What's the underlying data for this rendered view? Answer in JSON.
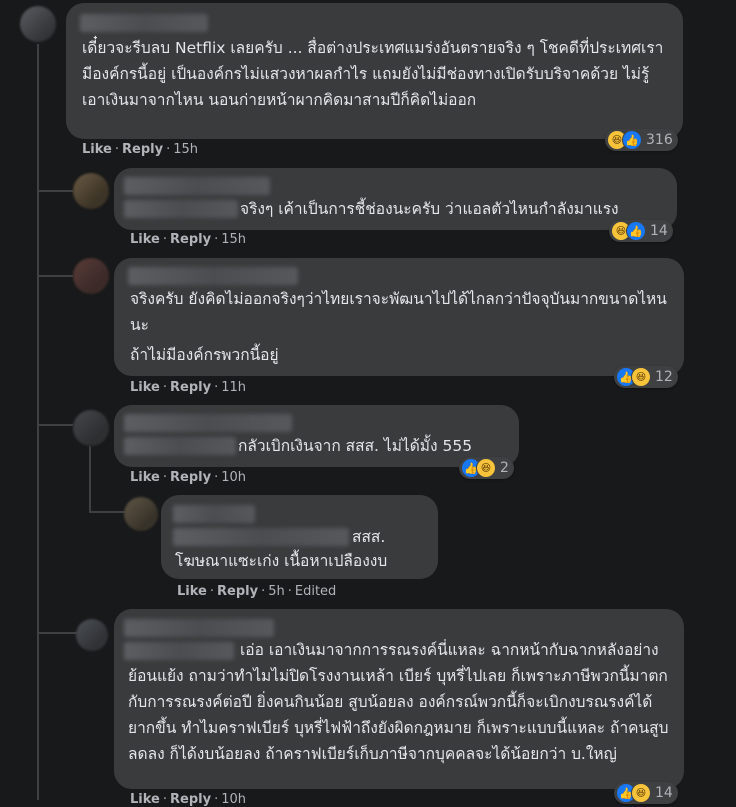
{
  "actions": {
    "like": "Like",
    "reply": "Reply",
    "separator": "·"
  },
  "comments": [
    {
      "text": "เดี๋ยวจะรีบลบ Netflix เลยครับ ... สื่อต่างประเทศแมร่งอันตรายจริง ๆ โชคดีที่ประเทศเรามีองค์กรนี้อยู่ เป็นองค์กรไม่แสวงหาผลกำไร แถมยังไม่มีช่องทางเปิดรับบริจาคด้วย ไม่รู้เอาเงินมาจากไหน นอนก่ายหน้าผากคิดมาสามปีก็คิดไม่ออก",
      "time": "15h",
      "reaction_count": "316",
      "reactions": [
        "haha",
        "like"
      ]
    },
    {
      "text": "จริงๆ เค้าเป็นการชี้ช่องนะครับ ว่าแอลตัวไหนกำลังมาแรง",
      "time": "15h",
      "reaction_count": "14",
      "reactions": [
        "haha",
        "like"
      ]
    },
    {
      "text_line1": "จริงครับ ยังคิดไม่ออกจริงๆว่าไทยเราจะพัฒนาไปได้ไกลกว่าปัจจุบันมากขนาดไหนนะ",
      "text_line2": "ถ้าไม่มีองค์กรพวกนี้อยู่",
      "time": "11h",
      "reaction_count": "12",
      "reactions": [
        "like",
        "haha"
      ]
    },
    {
      "text": "กลัวเบิกเงินจาก สสส. ไม่ได้มั้ง 555",
      "time": "10h",
      "reaction_count": "2",
      "reactions": [
        "like",
        "haha"
      ]
    },
    {
      "text_line1": "สสส.",
      "text_line2": "โฆษณาแซะเก่ง เนื้อหาเปลืองงบ",
      "time": "5h",
      "edited": "Edited"
    },
    {
      "text": "เอ่อ เอาเงินมาจากการรณรงค์นี่แหละ ฉากหน้ากับฉากหลังอย่างย้อนแย้ง ถามว่าทำไมไม่ปิดโรงงานเหล้า เบียร์ บุหรี่ไปเลย ก็เพราะภาษีพวกนี้มาตกกับการรณรงค์ต่อปี ยิ่งคนกินน้อย สูบน้อยลง องค์กรณ์พวกนี้ก็จะเบิกงบรณรงค์ได้ยากขึ้น ทำไมคราฟเบียร์ บุหรี่ไฟฟ้าถึงยังผิดกฎหมาย ก็เพราะแบบนี้แหละ ถ้าคนสูบลดลง ก็ได้งบน้อยลง ถ้าคราฟเบียร์เก็บภาษีจากบุคคลจะได้น้อยกว่า บ.ใหญ่",
      "time": "10h",
      "reaction_count": "14",
      "reactions": [
        "like",
        "haha"
      ]
    }
  ],
  "colors": {
    "background": "#18191a",
    "bubble": "#3a3b3c",
    "text": "#e4e6eb",
    "meta": "#b0b3b8",
    "like": "#1877f2",
    "haha": "#f7c33b"
  }
}
